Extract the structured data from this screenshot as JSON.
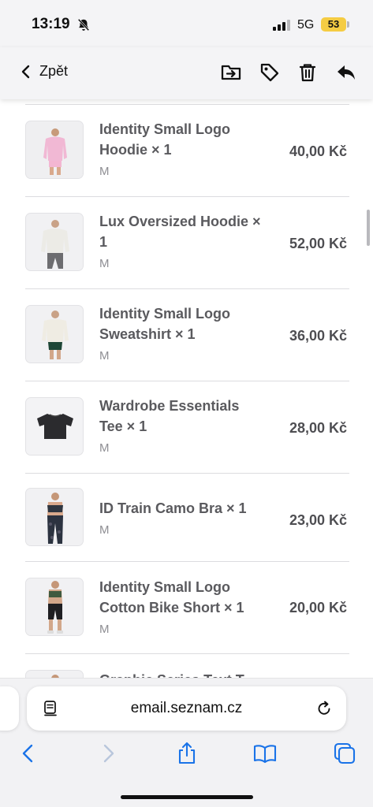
{
  "status_bar": {
    "time": "13:19",
    "network": "5G",
    "battery": "53",
    "icons": [
      "bell-off-icon",
      "signal-icon",
      "battery-icon"
    ]
  },
  "toolbar": {
    "back_label": "Zpět",
    "icons": [
      "move-to-folder-icon",
      "tag-icon",
      "trash-icon",
      "reply-icon"
    ]
  },
  "order_items": [
    {
      "name": "Identity Small Logo Hoodie × 1",
      "size": "M",
      "price": "40,00 Kč"
    },
    {
      "name": "Lux Oversized Hoodie × 1",
      "size": "M",
      "price": "52,00 Kč"
    },
    {
      "name": "Identity Small Logo Sweatshirt × 1",
      "size": "M",
      "price": "36,00 Kč"
    },
    {
      "name": "Wardrobe Essentials Tee × 1",
      "size": "M",
      "price": "28,00 Kč"
    },
    {
      "name": "ID Train Camo Bra × 1",
      "size": "M",
      "price": "23,00 Kč"
    },
    {
      "name": "Identity Small Logo Cotton Bike Short × 1",
      "size": "M",
      "price": "20,00 Kč"
    },
    {
      "name": "Graphic Series Text T",
      "size": "",
      "price": ""
    }
  ],
  "browser": {
    "url": "email.seznam.cz",
    "icons": [
      "reader-icon",
      "reload-icon",
      "back-icon",
      "forward-icon",
      "share-icon",
      "bookmarks-icon",
      "tabs-icon"
    ]
  },
  "colors": {
    "accent": "#1a73e8",
    "battery": "#f5cc43",
    "text_muted": "#5a5a5e"
  }
}
